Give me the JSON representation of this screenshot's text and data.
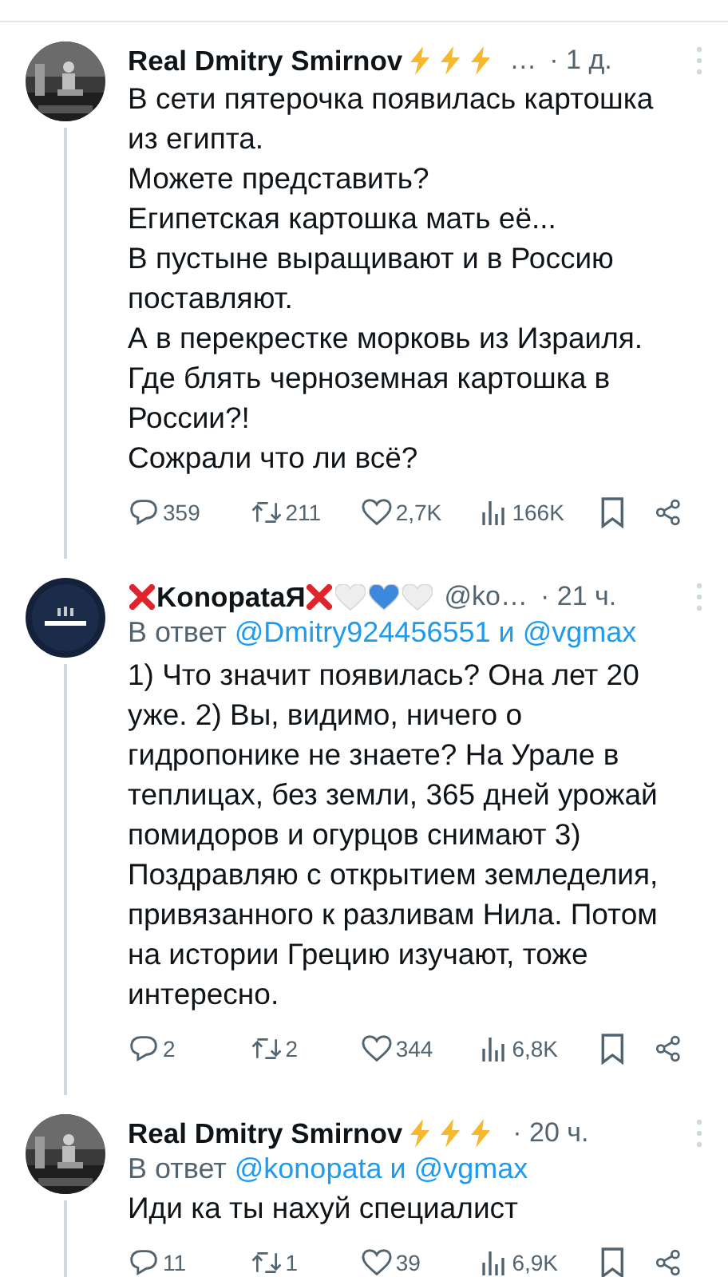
{
  "tweets": [
    {
      "author": "Real Dmitry Smirnov",
      "kind": "lightning",
      "handle": "…",
      "time": "· 1 д.",
      "body": [
        "В сети пятерочка появилась картошка из египта.",
        "Можете представить?",
        "Египетская картошка мать её...",
        "В пустыне выращивают и в Россию поставляют.",
        "А в перекрестке морковь из Израиля.",
        "Где блять черноземная картошка в России?!",
        "Сожрали что ли всё?"
      ],
      "stats": {
        "replies": "359",
        "reposts": "211",
        "likes": "2,7K",
        "views": "166K"
      }
    },
    {
      "author": "KonopataЯ",
      "kind": "cross_hearts",
      "handle": "@ko…",
      "time": "· 21 ч.",
      "reply_to": {
        "prefix": "В ответ",
        "first": "@Dmitry924456551",
        "joiner": "и",
        "second": "@vgmax"
      },
      "body": [
        "1) Что значит появилась? Она лет 20 уже. 2) Вы, видимо, ничего о гидропонике не знаете? На Урале в теплицах, без земли, 365 дней урожай помидоров и огурцов снимают 3) Поздравляю с открытием земледелия, привязанного к разливам Нила. Потом на истории Грецию изучают, тоже интересно."
      ],
      "stats": {
        "replies": "2",
        "reposts": "2",
        "likes": "344",
        "views": "6,8K"
      }
    },
    {
      "author": "Real Dmitry Smirnov",
      "kind": "lightning",
      "time": "· 20 ч.",
      "reply_to": {
        "prefix": "В ответ",
        "first": "@konopata",
        "joiner": "и",
        "second": "@vgmax"
      },
      "body": [
        "Иди ка ты нахуй специалист"
      ],
      "stats": {
        "replies": "11",
        "reposts": "1",
        "likes": "39",
        "views": "6,9K"
      }
    }
  ]
}
